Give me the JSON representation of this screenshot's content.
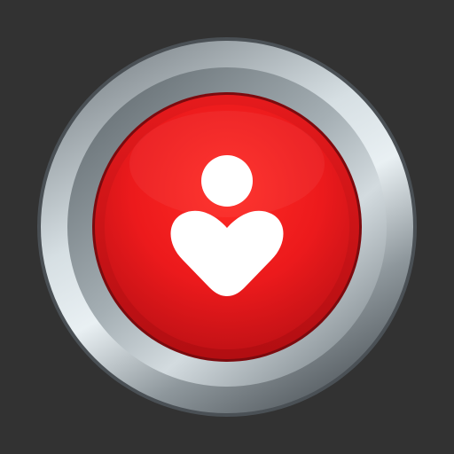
{
  "app_icon": {
    "background_color": "#333333",
    "bezel_colors": [
      "#e6eef2",
      "#b9c3c8",
      "#7d868c",
      "#5f666b"
    ],
    "button_color": "#e8191b",
    "button_rim_color": "#8c0c10",
    "glyph_color": "#ffffff",
    "glyph_icon": "person-with-heart-icon"
  }
}
